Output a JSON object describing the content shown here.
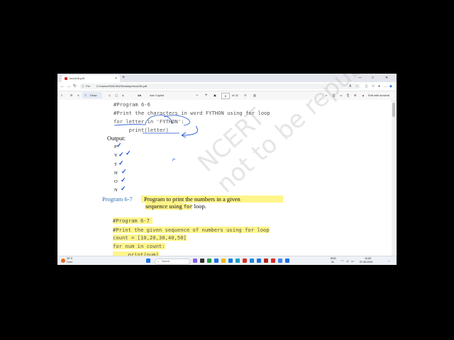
{
  "browser": {
    "tab_title": "Iecs106.pdf",
    "tab_close": "×",
    "new_tab": "+",
    "win_min": "—",
    "win_max": "□",
    "win_close": "✕",
    "back": "←",
    "forward": "→",
    "reload": "↻",
    "scheme": "File",
    "url": "C:/Users/91NCWU/Desktop/Iecs106.pdf"
  },
  "pdf_toolbar": {
    "menu_icon": "≡",
    "draw_label": "Draw",
    "ask_copilot": "Ask Copilot",
    "zoom_out": "−",
    "zoom_in": "+",
    "page_current": "8",
    "page_total": "of 22",
    "edit_acrobat": "Edit with Acrobat"
  },
  "document": {
    "prog66": {
      "line1": "#Program 6-6",
      "line2": "#Print the characters in word FYTHON using for loop",
      "line3": "for letter in 'FYTHON':",
      "line4": "     print(letter)"
    },
    "output_label": "Output:",
    "output_chars": [
      "P",
      "Y",
      "T",
      "H",
      "O",
      "N"
    ],
    "prog67_label": "Program 6-7",
    "prog67_desc1": "Program to print the numbers in a given",
    "prog67_desc2_a": "sequence using ",
    "prog67_desc2_for": "for",
    "prog67_desc2_b": " loop.",
    "prog67": {
      "line1": "#Program 6-7",
      "line2": "#Print the given sequence of numbers using for loop",
      "line3": "count = [10,20,30,40,50]",
      "line4": "for num in count:",
      "line5": "     print(num)"
    },
    "watermark": "NCERT\nnot to be republished"
  },
  "taskbar": {
    "weather_temp": "32°C",
    "weather_desc": "Haze",
    "search_placeholder": "Search",
    "lang": "ENG",
    "lang_region": "IN",
    "time": "10:50",
    "date": "07-06-2024"
  },
  "colors": {
    "highlight": "#fff58a",
    "ink_blue": "#1a4fd6",
    "program_label_blue": "#2d6eaa"
  }
}
